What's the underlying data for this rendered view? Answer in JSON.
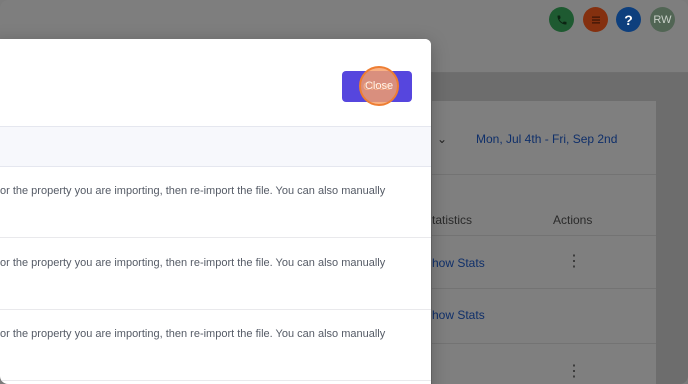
{
  "header": {
    "avatar_initials": "RW",
    "help_glyph": "?",
    "icons": [
      "phone-icon",
      "list-icon",
      "help-icon"
    ],
    "colors": {
      "phone": "#1e5a31",
      "list": "#84300f",
      "help": "#0d3f7d",
      "avatar": "#516554"
    }
  },
  "background_card": {
    "date_range": "Mon, Jul 4th - Fri, Sep 2nd",
    "columns": {
      "statistics": "tatistics",
      "actions": "Actions"
    },
    "rows": [
      {
        "link": "how Stats"
      },
      {
        "link": "how Stats"
      },
      {
        "link": ""
      }
    ]
  },
  "modal": {
    "close_label": "Close",
    "accent": "#5646de",
    "errors": [
      {
        "line1": "or the property you are importing, then re-import the file. You can also manually",
        "line2": ""
      },
      {
        "line1": "or the property you are importing, then re-import the file. You can also manually",
        "line2": ""
      },
      {
        "line1": "or the property you are importing, then re-import the file. You can also manually",
        "line2": ""
      }
    ]
  }
}
